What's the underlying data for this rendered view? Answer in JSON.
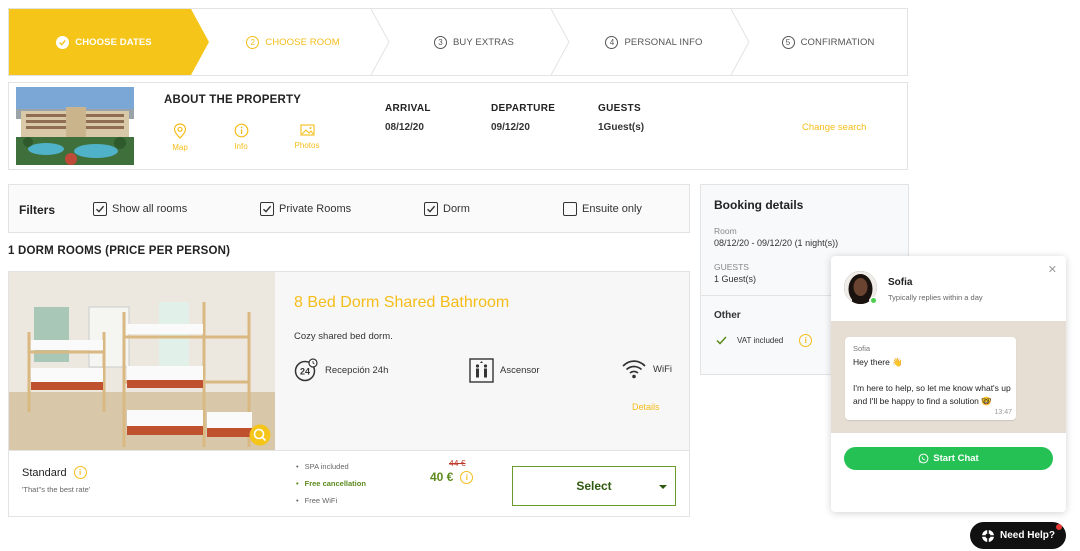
{
  "stepper": {
    "steps": [
      {
        "num": "",
        "label": "CHOOSE DATES"
      },
      {
        "num": "2",
        "label": "CHOOSE ROOM"
      },
      {
        "num": "3",
        "label": "BUY EXTRAS"
      },
      {
        "num": "4",
        "label": "PERSONAL INFO"
      },
      {
        "num": "5",
        "label": "CONFIRMATION"
      }
    ]
  },
  "property": {
    "title": "ABOUT THE PROPERTY",
    "links": [
      "Map",
      "Info",
      "Photos"
    ],
    "arrival_label": "ARRIVAL",
    "arrival_value": "08/12/20",
    "departure_label": "DEPARTURE",
    "departure_value": "09/12/20",
    "guests_label": "GUESTS",
    "guests_value": "1Guest(s)",
    "change_search": "Change search"
  },
  "filters": {
    "label": "Filters",
    "options": [
      {
        "label": "Show all rooms",
        "checked": true
      },
      {
        "label": "Private Rooms",
        "checked": true
      },
      {
        "label": "Dorm",
        "checked": true
      },
      {
        "label": "Ensuite only",
        "checked": false
      }
    ]
  },
  "section_title": "1 DORM ROOMS (PRICE PER PERSON)",
  "room": {
    "name": "8 Bed Dorm Shared Bathroom",
    "description": "Cozy shared bed dorm.",
    "amenities": [
      "Recepción 24h",
      "Ascensor",
      "WiFi"
    ],
    "details_link": "Details",
    "rate": {
      "name": "Standard",
      "subtitle": "'That''s the best rate'",
      "features": [
        "SPA included",
        "Free cancellation",
        "Free WiFi"
      ],
      "old_price": "44 €",
      "price": "40 €",
      "select_label": "Select"
    }
  },
  "booking": {
    "title": "Booking details",
    "room_label": "Room",
    "room_value": "08/12/20 - 09/12/20 (1 night(s))",
    "guests_label": "GUESTS",
    "guests_value": "1 Guest(s)",
    "other_label": "Other",
    "vat": "VAT included"
  },
  "chat": {
    "agent": "Sofia",
    "replies": "Typically replies within a day",
    "from": "Sofia",
    "line1": "Hey there 👋",
    "line2": "I'm here to help, so let me know what's up and I'll be happy to find a solution 🤓",
    "time": "13:47",
    "start_label": "Start Chat",
    "need_help": "Need Help?"
  },
  "colors": {
    "accent": "#f5bd19",
    "price_green": "#5d8a1e",
    "whatsapp_green": "#25c154"
  }
}
